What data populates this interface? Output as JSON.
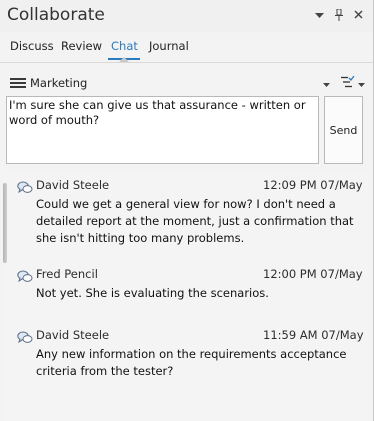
{
  "window": {
    "title": "Collaborate",
    "controls": [
      "chevron-down-icon",
      "pin-icon",
      "close-icon"
    ]
  },
  "tabs": [
    {
      "label": "Discuss",
      "active": false
    },
    {
      "label": "Review",
      "active": false
    },
    {
      "label": "Chat",
      "active": true
    },
    {
      "label": "Journal",
      "active": false
    }
  ],
  "toolbar": {
    "menu_icon": "hamburger-menu-icon",
    "channel": "Marketing",
    "filter_icon": "filter-list-icon"
  },
  "compose": {
    "value": "I'm sure she can give us that assurance - written or word of mouth?",
    "send_label": "Send"
  },
  "messages": [
    {
      "author": "David Steele",
      "time": "12:09 PM  07/May",
      "text": "Could we get a general view for now? I don't need a detailed report at the moment, just a confirmation that she isn't hitting too many problems.",
      "icon": "chat-bubbles-icon"
    },
    {
      "author": "Fred Pencil",
      "time": "12:00 PM  07/May",
      "text": "Not yet. She is evaluating the scenarios.",
      "icon": "chat-bubbles-icon"
    },
    {
      "author": "David Steele",
      "time": "11:59 AM  07/May",
      "text": "Any new information on the requirements acceptance criteria from the tester?",
      "icon": "chat-bubbles-icon"
    }
  ],
  "colors": {
    "accent": "#2a7bbd",
    "panel_bg": "#f3f3f3",
    "border": "#b9b9b9"
  }
}
